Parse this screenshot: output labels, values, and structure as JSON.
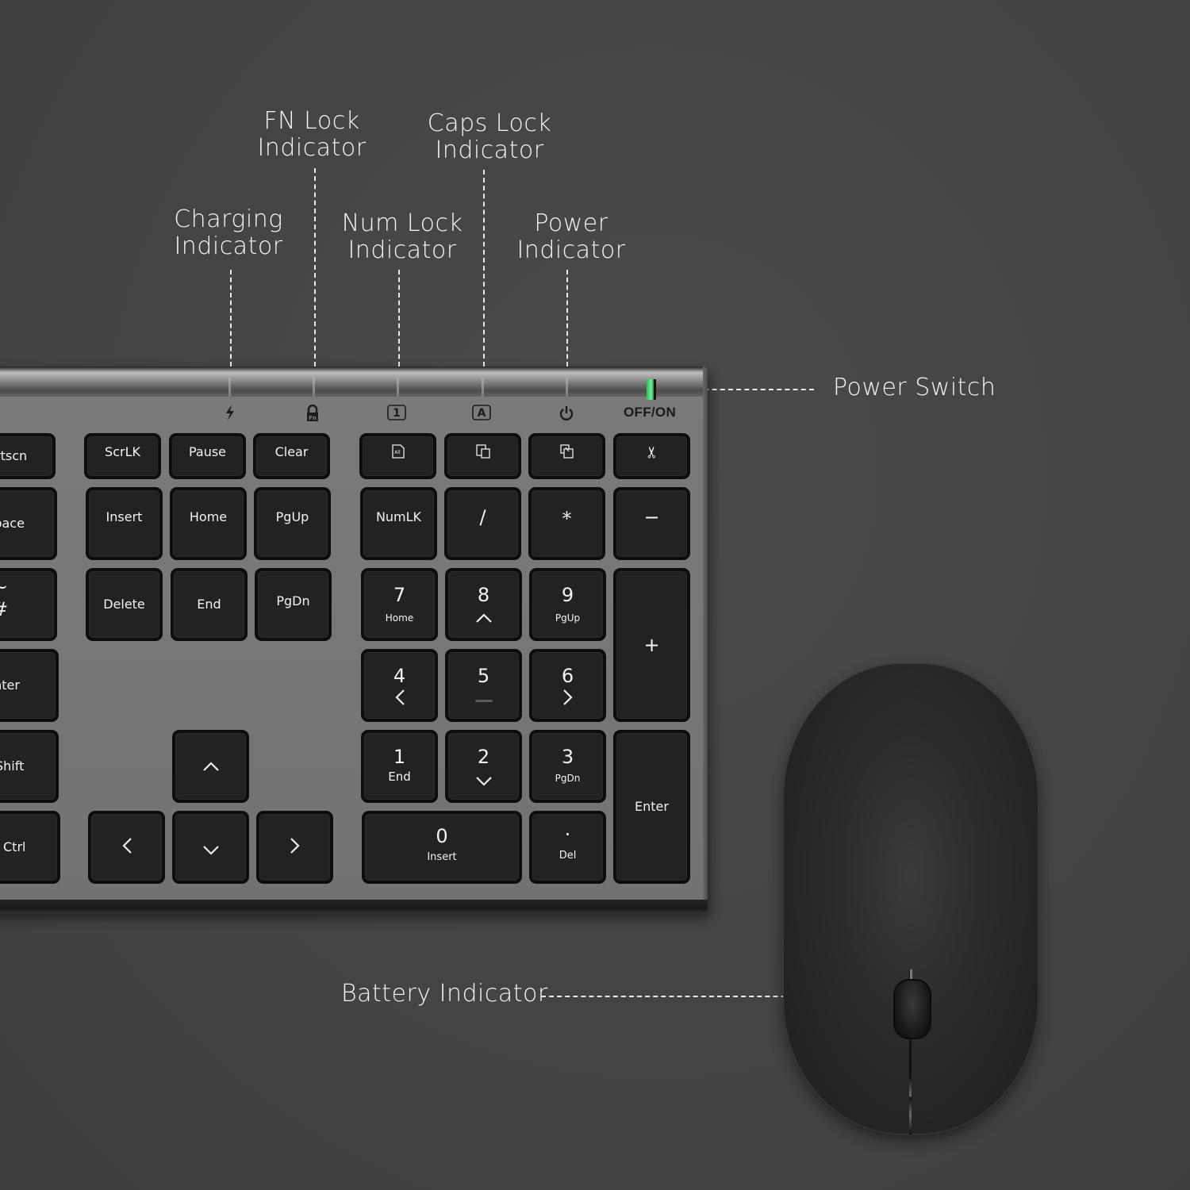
{
  "callouts": {
    "fn_lock": [
      "FN Lock",
      "Indicator"
    ],
    "caps_lock": [
      "Caps Lock",
      "Indicator"
    ],
    "charging": [
      "Charging",
      "Indicator"
    ],
    "num_lock": [
      "Num Lock",
      "Indicator"
    ],
    "power": [
      "Power",
      "Indicator"
    ],
    "power_switch": "Power Switch",
    "battery": "Battery Indicator"
  },
  "keyboard": {
    "indicator_icons": [
      "charging-icon",
      "fn-lock-icon",
      "num-lock-icon",
      "caps-lock-icon",
      "power-icon"
    ],
    "indicator_glyphs": [
      "⚡",
      "🔒",
      "1",
      "A",
      "⏻"
    ],
    "switch_label": "OFF/ON",
    "switch_color": "#3ddc6a",
    "keys": {
      "prtscn": "rtscn",
      "scrlk": "ScrLK",
      "pause": "Pause",
      "clear": "Clear",
      "select_all": "All",
      "copy_icon": "copy-icon",
      "paste_icon": "paste-icon",
      "cut_glyph": "✂",
      "backspace": "space",
      "insert": "Insert",
      "home": "Home",
      "pgup": "PgUp",
      "numlk": "NumLK",
      "divide": "/",
      "multiply": "*",
      "minus": "−",
      "hash_top": "~",
      "hash_bottom": "#",
      "delete": "Delete",
      "end": "End",
      "pgdn": "PgDn",
      "enter_main": "Enter",
      "shift": "Shift",
      "ctrl": "Ctrl",
      "arrow_up": "^",
      "arrow_left": "<",
      "arrow_down": "v",
      "arrow_right": ">",
      "np7": "7",
      "np7_sub": "Home",
      "np8": "8",
      "np8_sub": "^",
      "np9": "9",
      "np9_sub": "PgUp",
      "np4": "4",
      "np4_sub": "<",
      "np5": "5",
      "np6": "6",
      "np6_sub": ">",
      "np1": "1",
      "np1_sub": "End",
      "np2": "2",
      "np2_sub": "v",
      "np3": "3",
      "np3_sub": "PgDn",
      "np0": "0",
      "np0_sub": "Insert",
      "npdot": "·",
      "npdot_sub": "Del",
      "plus": "+",
      "np_enter": "Enter"
    }
  }
}
